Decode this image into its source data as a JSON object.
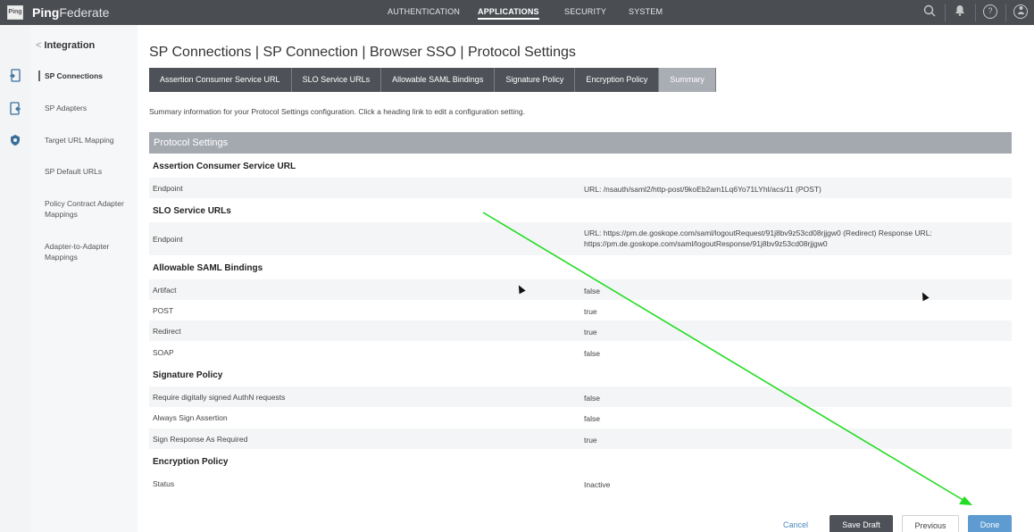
{
  "app": {
    "brand_bold": "Ping",
    "brand_light": "Federate",
    "logo_text": "Ping"
  },
  "topnav": {
    "authentication": "AUTHENTICATION",
    "applications": "APPLICATIONS",
    "security": "SECURITY",
    "system": "SYSTEM"
  },
  "subnav": {
    "back_label": "Integration",
    "items": [
      "SP Connections",
      "SP Adapters",
      "Target URL Mapping",
      "SP Default URLs",
      "Policy Contract Adapter Mappings",
      "Adapter-to-Adapter Mappings"
    ]
  },
  "breadcrumb": "SP Connections | SP Connection | Browser SSO | Protocol Settings",
  "tabs": [
    "Assertion Consumer Service URL",
    "SLO Service URLs",
    "Allowable SAML Bindings",
    "Signature Policy",
    "Encryption Policy",
    "Summary"
  ],
  "intro": "Summary information for your Protocol Settings configuration. Click a heading link to edit a configuration setting.",
  "section_title": "Protocol Settings",
  "summary": {
    "acs_heading": "Assertion Consumer Service URL",
    "acs_endpoint_label": "Endpoint",
    "acs_endpoint_value": "URL: /nsauth/saml2/http-post/9koEb2am1Lq6Yo71LYhI/acs/11 (POST)",
    "slo_heading": "SLO Service URLs",
    "slo_endpoint_label": "Endpoint",
    "slo_endpoint_value": "URL: https://pm.de.goskope.com/saml/logoutRequest/91j8bv9z53cd08rjjgw0 (Redirect) Response URL: https://pm.de.goskope.com/saml/logoutResponse/91j8bv9z53cd08rjjgw0",
    "bindings_heading": "Allowable SAML Bindings",
    "artifact_label": "Artifact",
    "artifact_value": "false",
    "post_label": "POST",
    "post_value": "true",
    "redirect_label": "Redirect",
    "redirect_value": "true",
    "soap_label": "SOAP",
    "soap_value": "false",
    "signature_heading": "Signature Policy",
    "sign_authn_label": "Require digitally signed AuthN requests",
    "sign_authn_value": "false",
    "sign_assertion_label": "Always Sign Assertion",
    "sign_assertion_value": "false",
    "sign_response_label": "Sign Response As Required",
    "sign_response_value": "true",
    "encryption_heading": "Encryption Policy",
    "status_label": "Status",
    "status_value": "Inactive"
  },
  "buttons": {
    "cancel": "Cancel",
    "save_draft": "Save Draft",
    "previous": "Previous",
    "done": "Done"
  },
  "colors": {
    "topbar": "#4a4d52",
    "tab_dark": "#4e5258",
    "tab_active": "#a9adb4",
    "section_bar": "#a4a9b0",
    "done_button": "#5d9bd0",
    "annotation_arrow": "#22dd22"
  }
}
